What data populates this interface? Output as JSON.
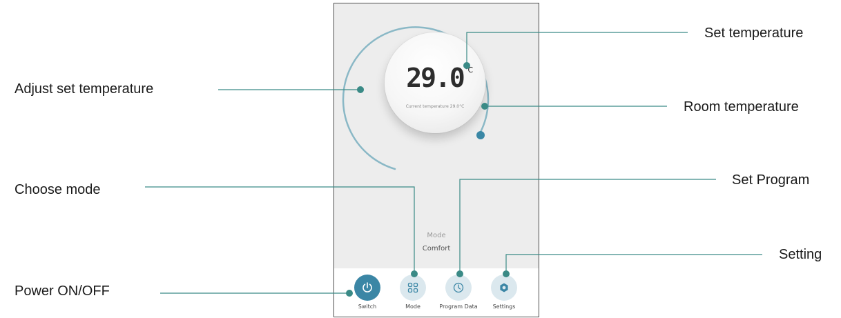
{
  "accent_color": "#3b86a5",
  "callout_color": "#3a8a86",
  "thermostat": {
    "set_temperature": "29.0",
    "unit": "℃",
    "current_temperature_text": "Current temperature 29.0°C",
    "mode_caption": "Mode",
    "mode_value": "Comfort"
  },
  "nav": [
    {
      "label": "Switch",
      "icon": "power-icon"
    },
    {
      "label": "Mode",
      "icon": "grid-icon"
    },
    {
      "label": "Program Data",
      "icon": "clock-icon"
    },
    {
      "label": "Settings",
      "icon": "gear-icon"
    }
  ],
  "callouts": {
    "adjust_set_temperature": "Adjust set temperature",
    "set_temperature": "Set temperature",
    "room_temperature": "Room temperature",
    "choose_mode": "Choose mode",
    "set_program": "Set Program",
    "setting": "Setting",
    "power": "Power ON/OFF"
  }
}
